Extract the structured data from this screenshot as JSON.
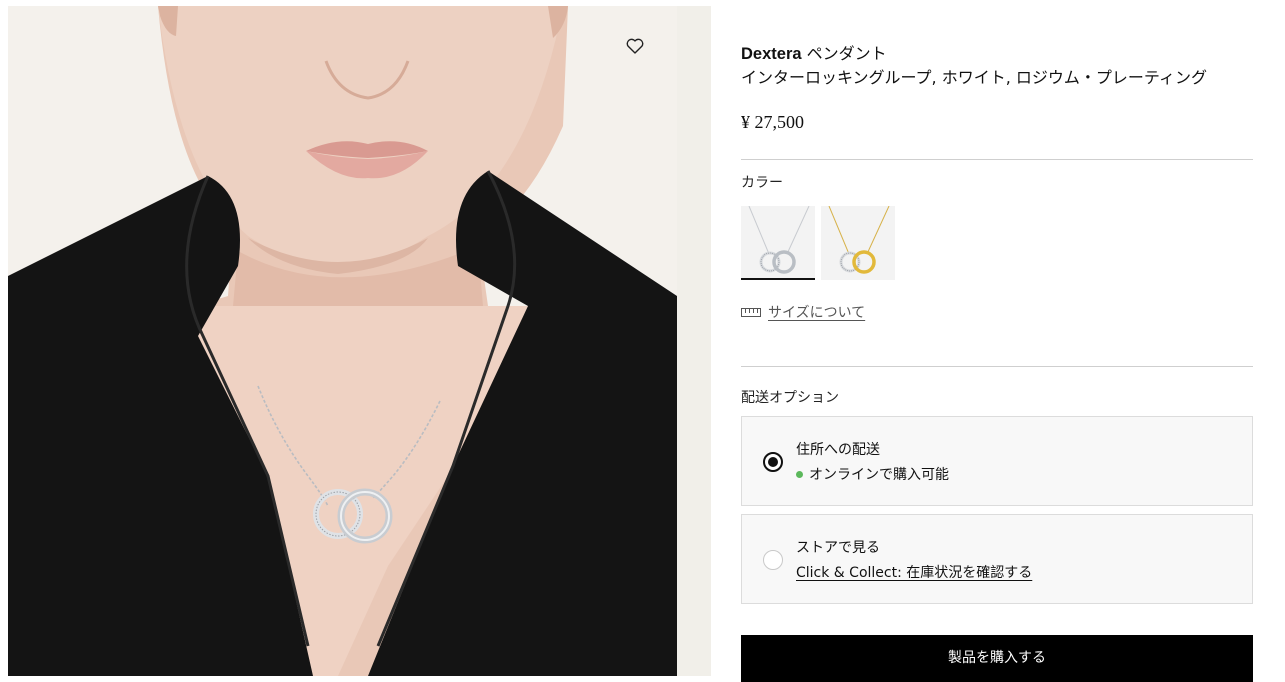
{
  "product": {
    "brand": "Dexterа",
    "type": "ペンダント",
    "subtitle": "インターロッキングループ, ホワイト, ロジウム・プレーティング",
    "price": "¥ 27,500"
  },
  "gallery": {
    "wishlist_icon": "heart-outline-icon"
  },
  "color": {
    "label": "カラー",
    "swatches": [
      {
        "name": "rhodium-white",
        "selected": true,
        "metal": "#c9ccd0"
      },
      {
        "name": "gold-tone",
        "selected": false,
        "metal": "#e2b93b"
      }
    ]
  },
  "size_guide": {
    "icon": "ruler-icon",
    "label": "サイズについて"
  },
  "shipping": {
    "label": "配送オプション",
    "options": [
      {
        "title": "住所への配送",
        "detail": "オンラインで購入可能",
        "selected": true,
        "status_color": "#5cb85c"
      },
      {
        "title": "ストアで見る",
        "detail": "Click & Collect: 在庫状況を確認する",
        "selected": false
      }
    ]
  },
  "cta": {
    "buy_label": "製品を購入する"
  },
  "colors": {
    "button_bg": "#000000",
    "button_text": "#ffffff",
    "available_dot": "#5cb85c"
  }
}
